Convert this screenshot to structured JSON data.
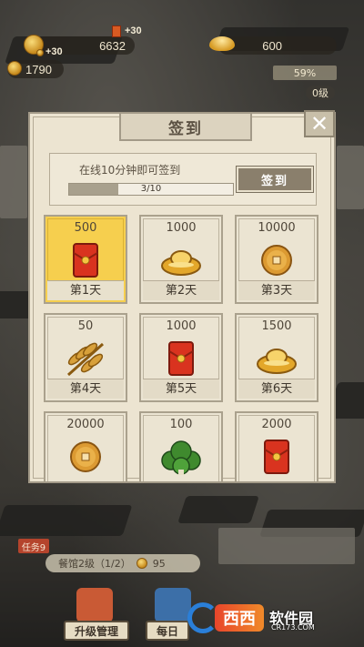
{
  "hud": {
    "reward_popup": "+30",
    "reward_small": "+30",
    "silver": "6632",
    "gold_ingot": "600",
    "copper": "1790",
    "progress_percent": "59%",
    "zero_badge": "0级"
  },
  "modal": {
    "title": "签到",
    "close_symbol": "✕",
    "status_text": "在线10分钟即可签到",
    "online_minutes_done": 3,
    "online_minutes_total": 10,
    "progress_label": "3/10",
    "signin_button": "签到",
    "days": [
      {
        "amount": "500",
        "icon": "red-envelope-icon",
        "label": "第1天",
        "active": true
      },
      {
        "amount": "1000",
        "icon": "gold-ingot-icon",
        "label": "第2天",
        "active": false
      },
      {
        "amount": "10000",
        "icon": "copper-coin-icon",
        "label": "第3天",
        "active": false
      },
      {
        "amount": "50",
        "icon": "wheat-icon",
        "label": "第4天",
        "active": false
      },
      {
        "amount": "1000",
        "icon": "red-envelope-icon",
        "label": "第5天",
        "active": false
      },
      {
        "amount": "1500",
        "icon": "gold-ingot-icon",
        "label": "第6天",
        "active": false
      },
      {
        "amount": "20000",
        "icon": "copper-coin-icon",
        "label": "",
        "active": false
      },
      {
        "amount": "100",
        "icon": "vegetable-icon",
        "label": "",
        "active": false
      },
      {
        "amount": "2000",
        "icon": "red-envelope-icon",
        "label": "",
        "active": false
      }
    ]
  },
  "bottom": {
    "task_tag": "任务9",
    "task_text": "餐馆2级（1/2）",
    "task_reward": "95",
    "upgrade_button": "升级管理",
    "daily_button": "每日"
  },
  "watermark": {
    "logo_text": "西西",
    "brand": "软件园",
    "url": "CR173.COM"
  },
  "colors": {
    "panel_bg": "#ece4d1",
    "active_card": "#f6cf4e",
    "frame": "#a39a88",
    "button_bg": "#8a7f6c"
  }
}
